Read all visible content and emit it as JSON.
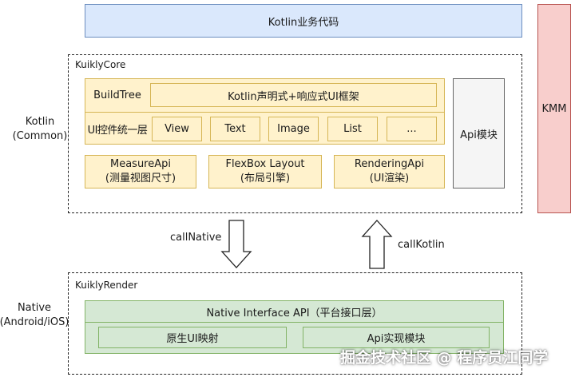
{
  "top": {
    "business": "Kotlin业务代码"
  },
  "kmm": "KMM",
  "kotlin_layer": {
    "line1": "Kotlin",
    "line2": "(Common)"
  },
  "native_layer": {
    "line1": "Native",
    "line2": "(Android/iOS)"
  },
  "core": {
    "title": "KuiklyCore",
    "build_tree_label": "BuildTree",
    "declarative_ui": "Kotlin声明式+响应式UI框架",
    "ui_unified_label": "UI控件统一层",
    "widgets": [
      "View",
      "Text",
      "Image",
      "List",
      "..."
    ],
    "api_module": "Api模块",
    "modules": [
      {
        "line1": "MeasureApi",
        "line2": "(测量视图尺寸)"
      },
      {
        "line1": "FlexBox Layout",
        "line2": "(布局引擎)"
      },
      {
        "line1": "RenderingApi",
        "line2": "(UI渲染)"
      }
    ]
  },
  "arrows": {
    "down_label": "callNative",
    "up_label": "callKotlin"
  },
  "render": {
    "title": "KuiklyRender",
    "interface": "Native Interface API（平台接口层）",
    "native_ui_mapping": "原生UI映射",
    "api_impl": "Api实现模块"
  },
  "watermark": "掘金技术社区 @ 程序员江同学"
}
